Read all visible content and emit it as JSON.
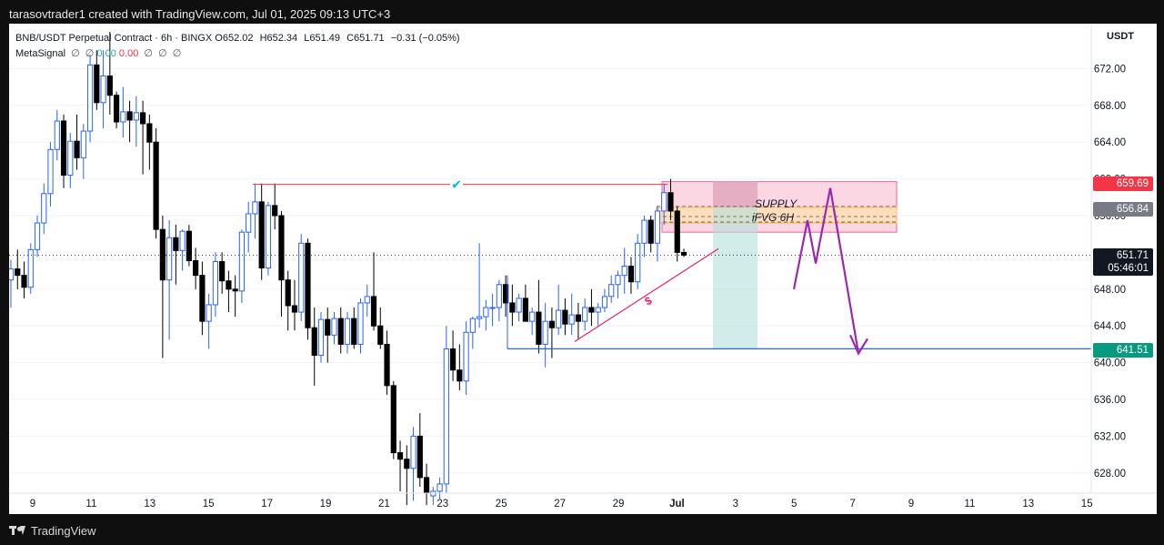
{
  "caption": "tarasovtrader1 created with TradingView.com, Jul 01, 2025 09:13 UTC+3",
  "brand": "TradingView",
  "legend": {
    "title": "BNB/USDT Perpetual Contract · 6h · BINGX",
    "o_label": "O",
    "o": "652.02",
    "h_label": "H",
    "h": "652.34",
    "l_label": "L",
    "l": "651.49",
    "c_label": "C",
    "c": "651.71",
    "change": "−0.31 (−0.05%)",
    "indicator": "MetaSignal",
    "ind_val1": "0.00",
    "ind_val2": "0.00",
    "ind_icon": "∅"
  },
  "currency": "USDT",
  "price_tags": {
    "supply_top": "659.69",
    "supply_mid": "656.84",
    "last_price": "651.71",
    "countdown": "05:46:01",
    "target": "641.51"
  },
  "annotations": {
    "supply": "SUPPLY",
    "ifvg": "iFVG 6H",
    "check": "✔",
    "dollar": "$"
  },
  "colors": {
    "bull": "#2962ff",
    "bear": "#000000",
    "supply_fill": "#f8bbd0",
    "ifvg_fill": "#ffe0b2",
    "target_line": "#2962ff",
    "path": "#9c27b0",
    "check": "#00bcd4",
    "dollar": "#e91e63"
  },
  "chart_data": {
    "type": "candlestick",
    "symbol": "BNB/USDT Perpetual Contract",
    "interval": "6h",
    "exchange": "BINGX",
    "ylim": [
      624,
      676
    ],
    "y_ticks": [
      "672.00",
      "668.00",
      "664.00",
      "660.00",
      "656.00",
      "652.00",
      "648.00",
      "644.00",
      "640.00",
      "636.00",
      "632.00",
      "628.00"
    ],
    "x_ticks": [
      "9",
      "11",
      "13",
      "15",
      "17",
      "19",
      "21",
      "23",
      "25",
      "27",
      "29",
      "Jul",
      "3",
      "5",
      "7",
      "9",
      "11",
      "13",
      "15"
    ],
    "last_price": 651.71,
    "levels": {
      "resistance": 659.4,
      "supply_zone": [
        654.2,
        659.7
      ],
      "ifvg_zone": [
        655.2,
        656.9
      ],
      "target": 641.51
    },
    "candles": [
      [
        649.0,
        651.2,
        646.0,
        650.2
      ],
      [
        650.2,
        652.3,
        648.0,
        649.5
      ],
      [
        649.5,
        651.0,
        647.0,
        648.2
      ],
      [
        648.2,
        653.0,
        647.5,
        652.3
      ],
      [
        652.3,
        656.0,
        651.5,
        655.2
      ],
      [
        655.2,
        659.5,
        654.0,
        658.4
      ],
      [
        658.4,
        664.0,
        657.0,
        663.2
      ],
      [
        663.2,
        667.5,
        662.0,
        666.3
      ],
      [
        666.3,
        667.0,
        659.0,
        660.4
      ],
      [
        660.4,
        665.0,
        659.0,
        664.1
      ],
      [
        664.1,
        667.0,
        661.0,
        662.3
      ],
      [
        662.3,
        666.0,
        660.0,
        665.2
      ],
      [
        665.2,
        673.5,
        664.0,
        672.4
      ],
      [
        672.4,
        674.0,
        667.5,
        668.3
      ],
      [
        668.3,
        674.0,
        665.5,
        671.2
      ],
      [
        671.2,
        676.0,
        667.0,
        669.1
      ],
      [
        669.1,
        669.5,
        665.5,
        666.2
      ],
      [
        666.2,
        670.0,
        664.5,
        667.3
      ],
      [
        667.3,
        668.5,
        664.0,
        666.4
      ],
      [
        666.4,
        669.0,
        663.5,
        667.2
      ],
      [
        667.2,
        668.5,
        660.5,
        666.0
      ],
      [
        666.0,
        667.0,
        661.0,
        664.0
      ],
      [
        664.0,
        665.5,
        653.5,
        654.5
      ],
      [
        654.5,
        656.0,
        640.5,
        649.0
      ],
      [
        649.0,
        655.5,
        642.5,
        653.6
      ],
      [
        653.6,
        655.0,
        648.5,
        652.2
      ],
      [
        652.2,
        654.5,
        650.0,
        654.3
      ],
      [
        654.3,
        655.0,
        650.5,
        651.1
      ],
      [
        651.1,
        652.5,
        648.0,
        649.5
      ],
      [
        649.5,
        651.0,
        643.0,
        644.5
      ],
      [
        644.5,
        647.5,
        641.5,
        646.3
      ],
      [
        646.3,
        652.0,
        645.0,
        651.0
      ],
      [
        651.0,
        652.0,
        647.5,
        648.9
      ],
      [
        648.9,
        650.0,
        645.5,
        648.0
      ],
      [
        648.0,
        649.5,
        645.0,
        647.8
      ],
      [
        647.8,
        654.5,
        646.5,
        654.2
      ],
      [
        654.2,
        657.5,
        652.0,
        656.2
      ],
      [
        656.2,
        659.5,
        653.5,
        657.5
      ],
      [
        657.5,
        659.5,
        649.0,
        650.3
      ],
      [
        650.3,
        657.5,
        649.5,
        657.1
      ],
      [
        657.1,
        659.5,
        654.5,
        656.0
      ],
      [
        656.0,
        656.5,
        645.0,
        649.0
      ],
      [
        649.0,
        650.0,
        643.5,
        646.2
      ],
      [
        646.2,
        649.0,
        643.5,
        645.5
      ],
      [
        645.5,
        654.0,
        644.5,
        653.0
      ],
      [
        653.0,
        653.5,
        642.5,
        643.8
      ],
      [
        643.8,
        646.0,
        637.5,
        640.8
      ],
      [
        640.8,
        645.5,
        640.0,
        644.7
      ],
      [
        644.7,
        646.0,
        640.0,
        643.0
      ],
      [
        643.0,
        645.5,
        642.0,
        644.8
      ],
      [
        644.8,
        646.0,
        641.0,
        642.0
      ],
      [
        642.0,
        645.5,
        641.0,
        644.8
      ],
      [
        644.8,
        646.0,
        641.5,
        642.0
      ],
      [
        642.0,
        647.0,
        641.0,
        646.5
      ],
      [
        646.5,
        648.5,
        645.0,
        647.2
      ],
      [
        647.2,
        652.0,
        643.5,
        644.0
      ],
      [
        644.0,
        646.0,
        641.5,
        642.0
      ],
      [
        642.0,
        643.5,
        636.5,
        637.5
      ],
      [
        637.5,
        638.0,
        629.5,
        630.2
      ],
      [
        630.2,
        631.5,
        626.0,
        629.5
      ],
      [
        629.5,
        631.0,
        624.5,
        628.5
      ],
      [
        628.5,
        633.0,
        625.0,
        632.0
      ],
      [
        632.0,
        634.5,
        626.5,
        627.5
      ],
      [
        627.5,
        629.0,
        624.5,
        625.8
      ],
      [
        625.5,
        626.5,
        624.5,
        626.0
      ],
      [
        626.0,
        627.5,
        625.2,
        626.8
      ],
      [
        626.8,
        644.0,
        625.8,
        641.5
      ],
      [
        641.5,
        643.5,
        638.0,
        639.2
      ],
      [
        639.2,
        642.0,
        637.0,
        638.0
      ],
      [
        638.0,
        644.5,
        636.5,
        643.3
      ],
      [
        643.3,
        645.0,
        641.5,
        644.8
      ],
      [
        644.8,
        653.0,
        643.8,
        645.0
      ],
      [
        645.0,
        646.8,
        643.5,
        646.0
      ],
      [
        646.0,
        647.5,
        644.0,
        646.0
      ],
      [
        646.0,
        649.0,
        644.5,
        648.5
      ],
      [
        648.5,
        649.5,
        645.0,
        646.5
      ],
      [
        646.5,
        648.5,
        644.0,
        645.5
      ],
      [
        645.5,
        647.5,
        644.5,
        647.0
      ],
      [
        647.0,
        648.5,
        644.5,
        644.5
      ],
      [
        644.5,
        646.0,
        643.0,
        645.5
      ],
      [
        645.5,
        649.0,
        641.0,
        642.0
      ],
      [
        642.0,
        646.5,
        639.5,
        644.5
      ],
      [
        644.5,
        646.0,
        640.5,
        643.8
      ],
      [
        643.8,
        648.5,
        643.0,
        645.7
      ],
      [
        645.7,
        647.0,
        643.0,
        644.2
      ],
      [
        644.2,
        647.5,
        643.0,
        645.2
      ],
      [
        645.2,
        646.5,
        642.5,
        644.5
      ],
      [
        644.5,
        647.0,
        643.5,
        646.0
      ],
      [
        646.0,
        648.0,
        644.0,
        645.5
      ],
      [
        645.5,
        646.5,
        644.0,
        646.0
      ],
      [
        646.0,
        648.0,
        645.5,
        647.2
      ],
      [
        647.2,
        649.5,
        646.5,
        648.5
      ],
      [
        648.5,
        650.0,
        647.0,
        649.5
      ],
      [
        649.5,
        652.5,
        647.5,
        650.5
      ],
      [
        650.5,
        651.5,
        647.5,
        648.8
      ],
      [
        648.8,
        654.0,
        648.0,
        653.0
      ],
      [
        653.0,
        656.0,
        651.5,
        655.5
      ],
      [
        655.5,
        656.0,
        652.0,
        653.0
      ],
      [
        653.0,
        657.0,
        651.0,
        656.5
      ],
      [
        656.5,
        659.5,
        655.0,
        658.5
      ],
      [
        658.5,
        660.0,
        655.5,
        656.5
      ],
      [
        656.5,
        657.0,
        651.0,
        652.0
      ],
      [
        652.0,
        652.4,
        651.5,
        651.7
      ]
    ]
  }
}
